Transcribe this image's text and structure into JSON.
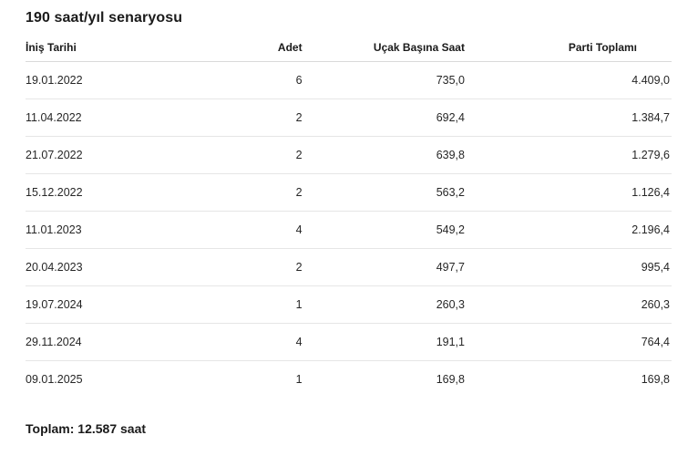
{
  "title": "190 saat/yıl senaryosu",
  "table": {
    "headers": {
      "date": "İniş Tarihi",
      "count": "Adet",
      "per_aircraft": "Uçak Başına Saat",
      "batch_total": "Parti Toplamı"
    },
    "rows": [
      {
        "date": "19.01.2022",
        "count": "6",
        "per_aircraft": "735,0",
        "batch_total": "4.409,0"
      },
      {
        "date": "11.04.2022",
        "count": "2",
        "per_aircraft": "692,4",
        "batch_total": "1.384,7"
      },
      {
        "date": "21.07.2022",
        "count": "2",
        "per_aircraft": "639,8",
        "batch_total": "1.279,6"
      },
      {
        "date": "15.12.2022",
        "count": "2",
        "per_aircraft": "563,2",
        "batch_total": "1.126,4"
      },
      {
        "date": "11.01.2023",
        "count": "4",
        "per_aircraft": "549,2",
        "batch_total": "2.196,4"
      },
      {
        "date": "20.04.2023",
        "count": "2",
        "per_aircraft": "497,7",
        "batch_total": "995,4"
      },
      {
        "date": "19.07.2024",
        "count": "1",
        "per_aircraft": "260,3",
        "batch_total": "260,3"
      },
      {
        "date": "29.11.2024",
        "count": "4",
        "per_aircraft": "191,1",
        "batch_total": "764,4"
      },
      {
        "date": "09.01.2025",
        "count": "1",
        "per_aircraft": "169,8",
        "batch_total": "169,8"
      }
    ]
  },
  "total_text": "Toplam: 12.587 saat"
}
